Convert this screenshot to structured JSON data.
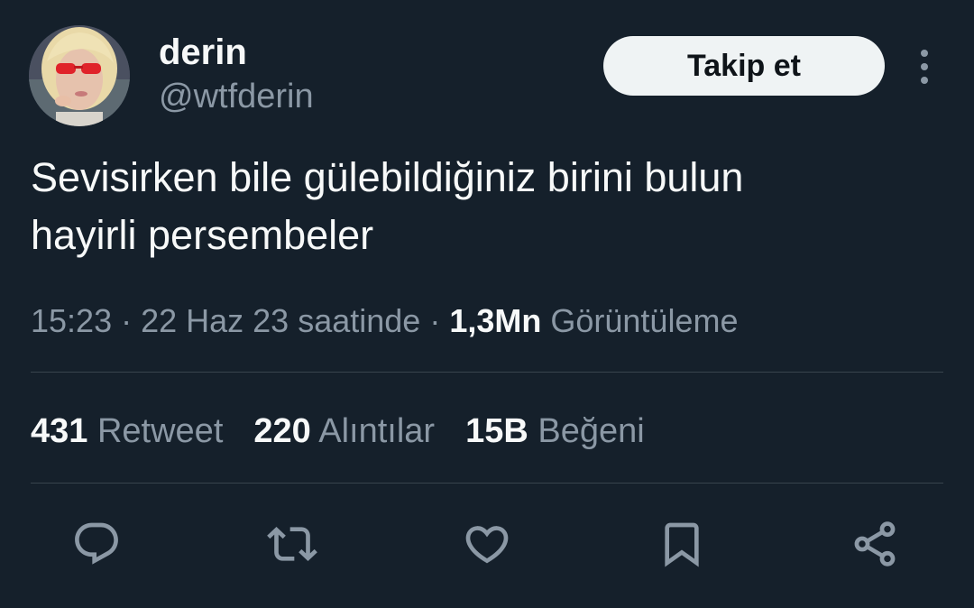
{
  "user": {
    "display_name": "derin",
    "handle": "@wtfderin",
    "avatar": "profile-photo"
  },
  "follow_button": {
    "label": "Takip et"
  },
  "more_menu": {
    "icon": "more-vertical-icon"
  },
  "tweet": {
    "text_line1": "Sevisirken bile gülebildiğiniz birini bulun",
    "text_line2": "hayirli persembeler"
  },
  "meta": {
    "time": "15:23",
    "sep1": " · ",
    "date": "22 Haz 23 saatinde",
    "sep2": " · ",
    "views_count": "1,3Mn",
    "views_label": "Görüntüleme"
  },
  "stats": [
    {
      "count": "431",
      "label": "Retweet"
    },
    {
      "count": "220",
      "label": "Alıntılar"
    },
    {
      "count": "15B",
      "label": "Beğeni"
    }
  ],
  "actions": [
    {
      "icon": "reply-icon"
    },
    {
      "icon": "retweet-icon"
    },
    {
      "icon": "like-icon"
    },
    {
      "icon": "bookmark-icon"
    },
    {
      "icon": "share-icon"
    }
  ],
  "colors": {
    "background": "#15202b",
    "text_primary": "#f7f9f9",
    "text_secondary": "#8b98a5",
    "divider": "#38444d",
    "button_bg": "#eff3f4",
    "button_text": "#0f1419"
  }
}
